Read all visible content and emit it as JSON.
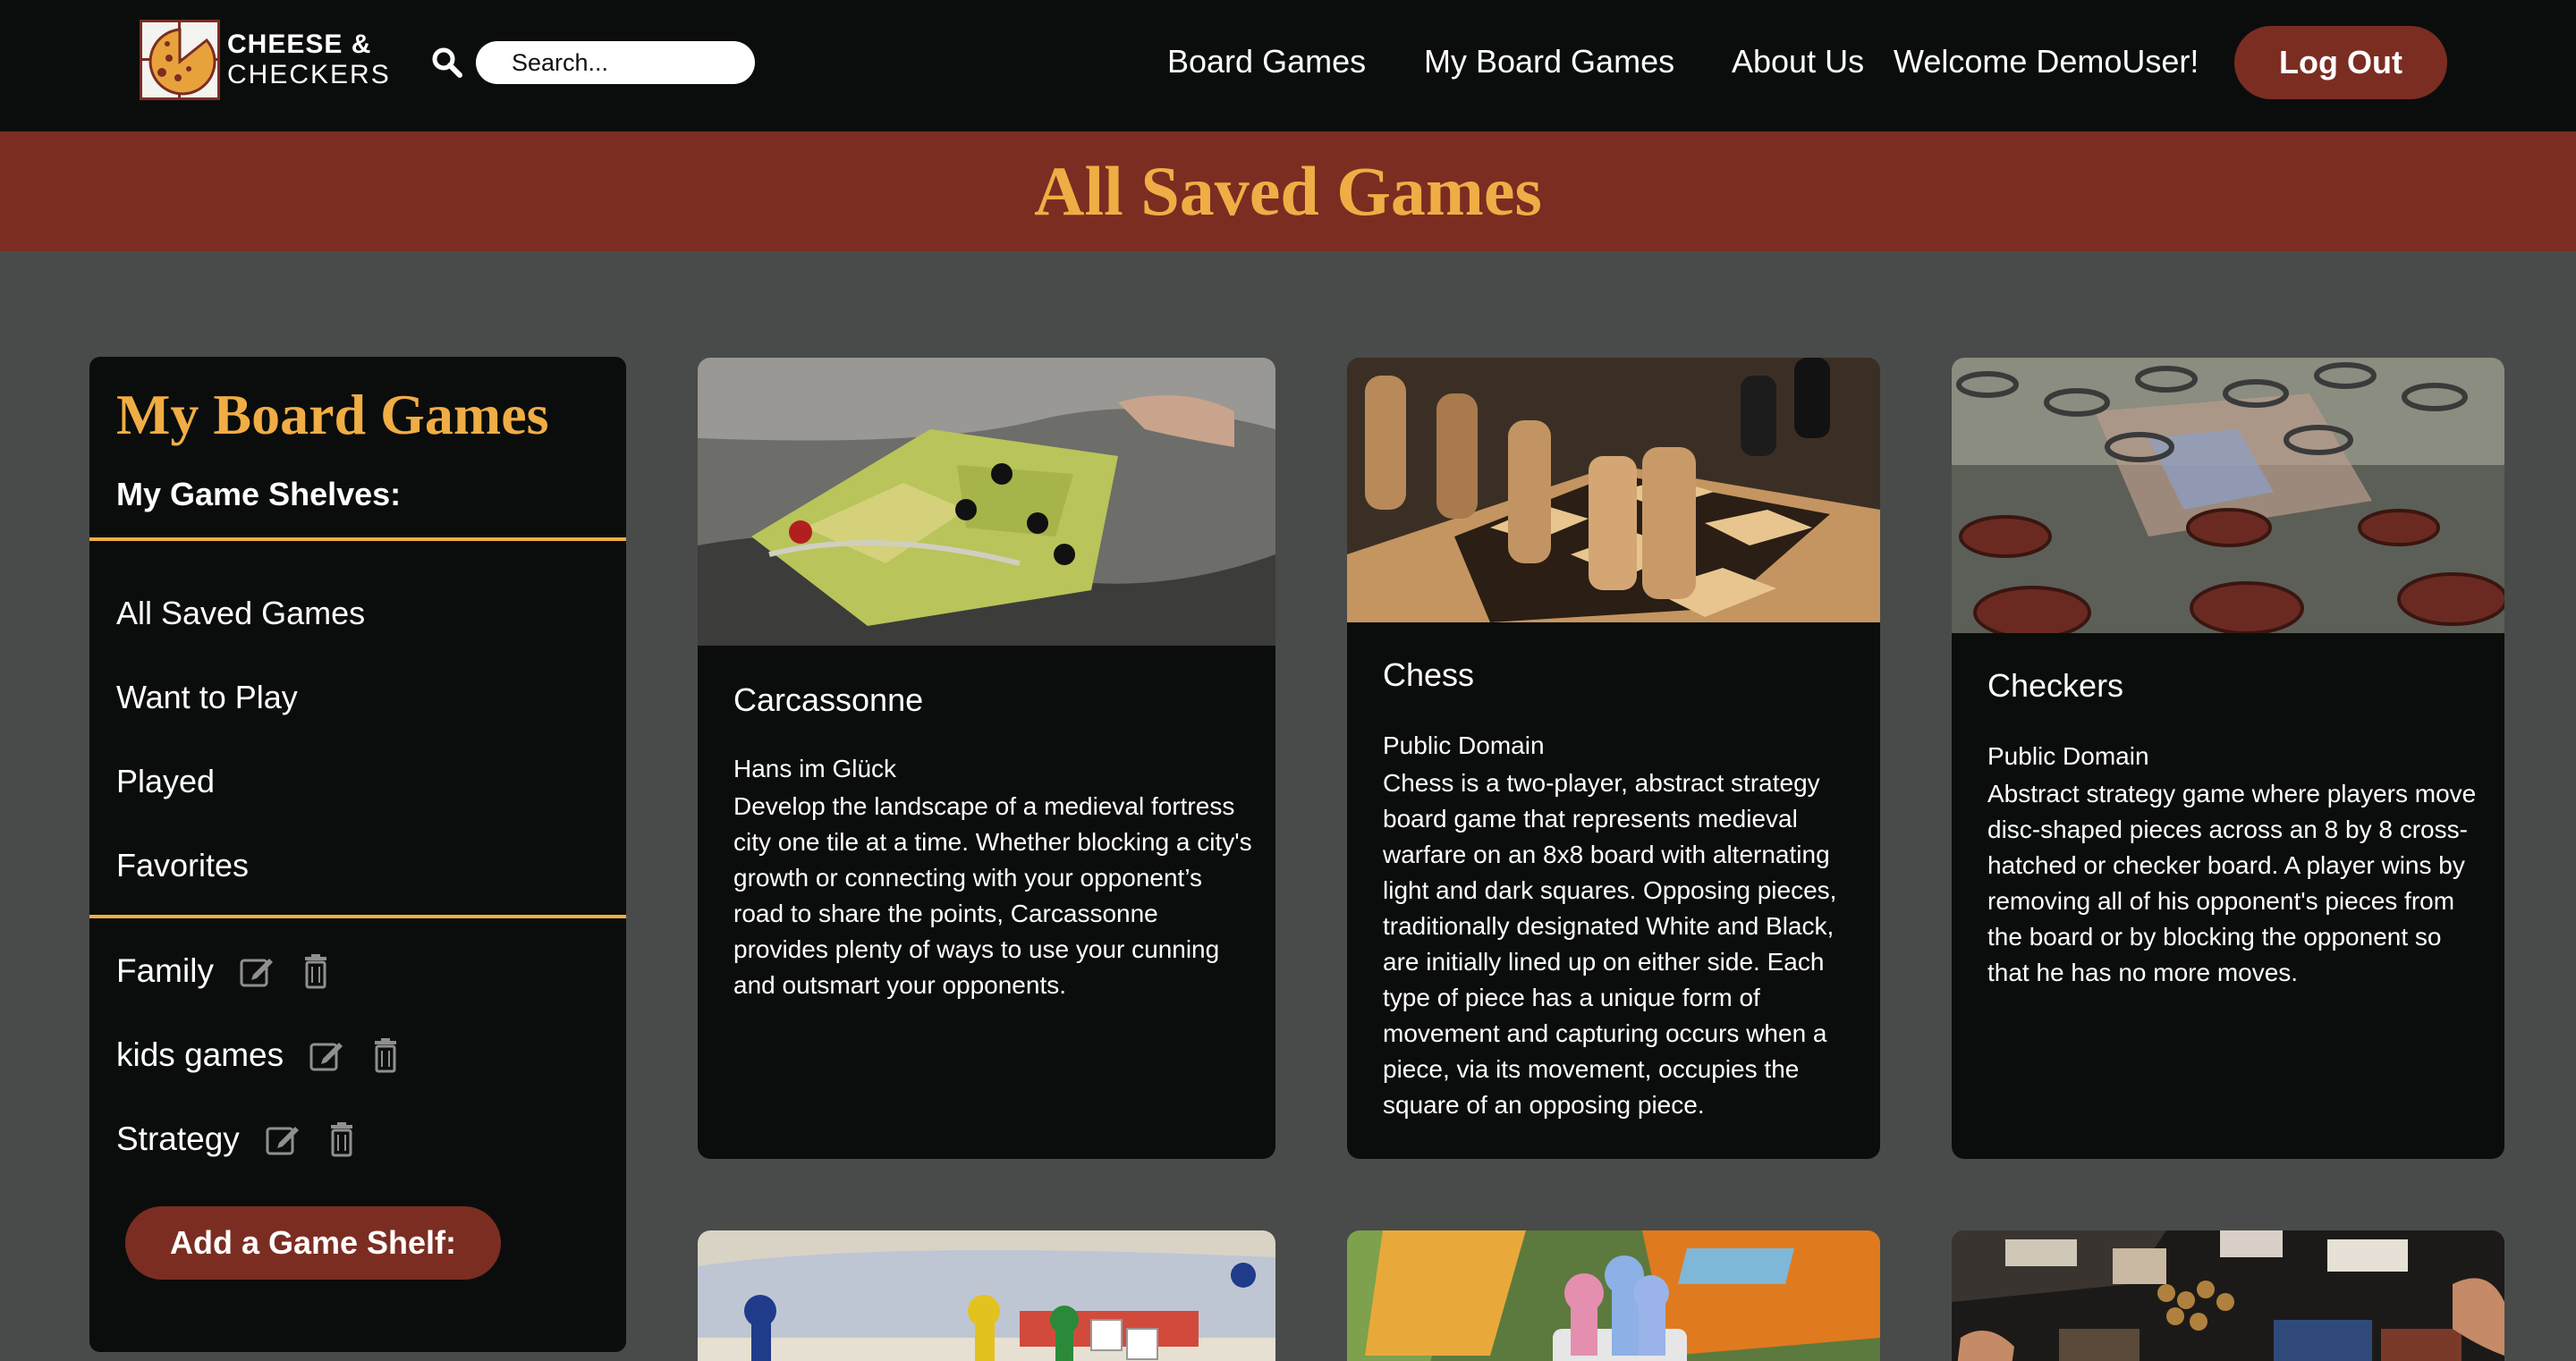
{
  "brand": {
    "line1": "CHEESE &",
    "line2": "CHECKERS"
  },
  "search": {
    "placeholder": "Search..."
  },
  "nav": {
    "board_games": "Board Games",
    "my_board_games": "My Board Games",
    "about_us": "About Us",
    "welcome": "Welcome DemoUser!",
    "logout": "Log Out"
  },
  "banner": {
    "title": "All Saved Games"
  },
  "sidebar": {
    "title": "My Board Games",
    "subtitle": "My Game Shelves:",
    "default_shelves": [
      "All Saved Games",
      "Want to Play",
      "Played",
      "Favorites"
    ],
    "custom_shelves": [
      "Family",
      "kids games",
      "Strategy"
    ],
    "add_button": "Add a Game Shelf:"
  },
  "games": [
    {
      "name": "Carcassonne",
      "publisher": "Hans im Glück",
      "description": "Develop the landscape of a medieval fortress city one tile at a time. Whether blocking a city's growth or connecting with your opponent’s road to share the points, Carcassonne provides plenty of ways to use your cunning and outsmart your opponents."
    },
    {
      "name": "Chess",
      "publisher": "Public Domain",
      "description": "Chess is a two-player, abstract strategy board game that represents medieval warfare on an 8x8 board with alternating light and dark squares. Opposing pieces, traditionally designated White and Black, are initially lined up on either side. Each type of piece has a unique form of movement and capturing occurs when a piece, via its movement, occupies the square of an opposing piece."
    },
    {
      "name": "Checkers",
      "publisher": "Public Domain",
      "description": "Abstract strategy game where players move disc-shaped pieces across an 8 by 8 cross-hatched or checker board. A player wins by removing all of his opponent's pieces from the board or by blocking the opponent so that he has no more moves."
    },
    {
      "name": "",
      "publisher": "",
      "description": ""
    },
    {
      "name": "",
      "publisher": "",
      "description": ""
    },
    {
      "name": "",
      "publisher": "",
      "description": ""
    }
  ],
  "colors": {
    "page_bg": "#484b49",
    "nav_bg": "#0b0d0c",
    "accent_red": "#7b2d22",
    "accent_gold": "#f0ad45"
  }
}
